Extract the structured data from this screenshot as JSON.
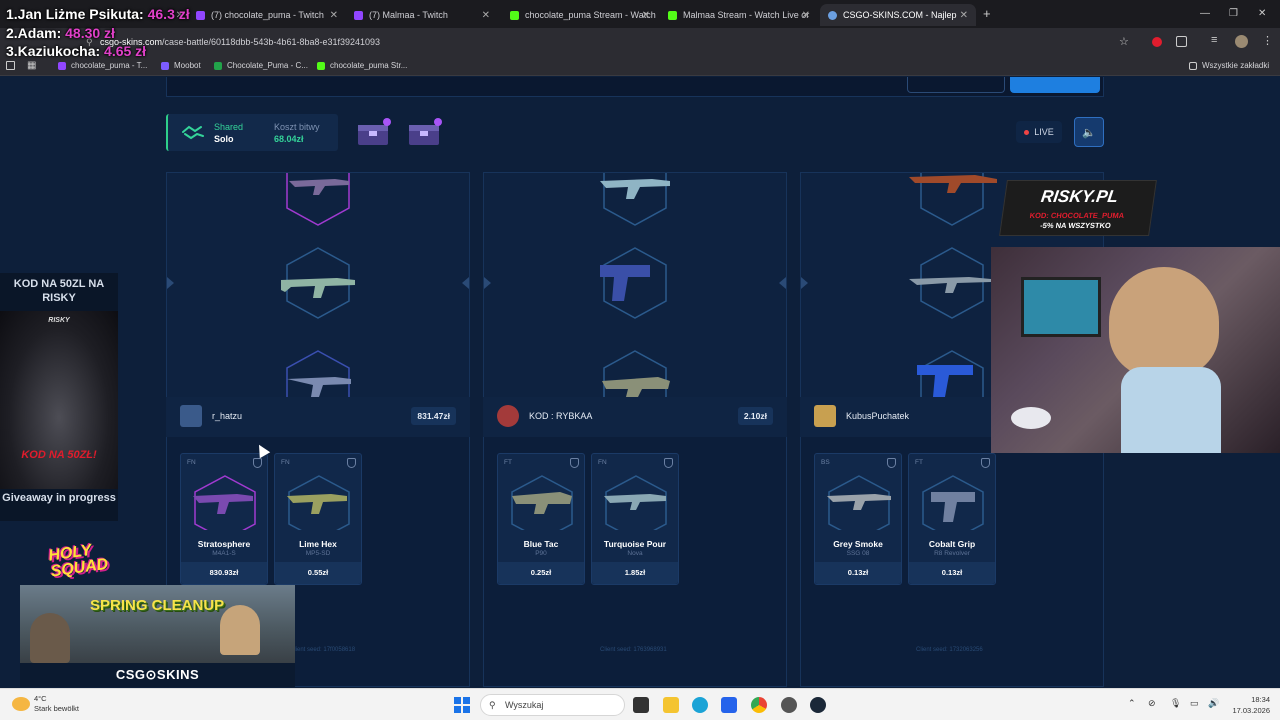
{
  "browser": {
    "tabs": [
      {
        "label": "",
        "color": "#9146ff"
      },
      {
        "label": "(7) chocolate_puma - Twitch",
        "color": "#9146ff"
      },
      {
        "label": "(7) Malmaa - Twitch",
        "color": "#9146ff"
      },
      {
        "label": "chocolate_puma Stream - Watch",
        "color": "#53fc18"
      },
      {
        "label": "Malmaa Stream - Watch Live or",
        "color": "#53fc18"
      },
      {
        "label": "CSGO-SKINS.COM - Najlep",
        "color": "#6b9fe0"
      }
    ],
    "url_domain": "csgo-skins.com",
    "url_path": "/case-battle/60118dbb-543b-4b61-8ba8-e31f39241093",
    "bookmarks": [
      {
        "label": "chocolate_puma - T...",
        "color": "#9146ff"
      },
      {
        "label": "Moobot",
        "color": "#7c5cff"
      },
      {
        "label": "Chocolate_Puma - C...",
        "color": "#22a34a"
      },
      {
        "label": "chocolate_puma Str...",
        "color": "#53fc18"
      }
    ],
    "bookmarks_right": "Wszystkie zakładki"
  },
  "leaderboard": [
    {
      "rank_name": "1.Jan Liżme Psikuta:",
      "amount": "46.3 zł"
    },
    {
      "rank_name": "2.Adam:",
      "amount": "48.30 zł"
    },
    {
      "rank_name": "3.Kaziukocha:",
      "amount": "4.65 zł"
    }
  ],
  "battle": {
    "mode_label": "Shared",
    "mode_value": "Solo",
    "cost_label": "Koszt bitwy",
    "cost_value": "68.04zł",
    "live_label": "LIVE",
    "players": [
      {
        "name": "r_hatzu",
        "total": "831.47zł",
        "avatar_color": "#3a5a8a",
        "items": [
          {
            "cond": "FN",
            "name": "Stratosphere",
            "weapon": "M4A1-S",
            "price": "830.93zł"
          },
          {
            "cond": "FN",
            "name": "Lime Hex",
            "weapon": "MP5-SD",
            "price": "0.55zł"
          }
        ],
        "seed": "Client seed: 17f0058618"
      },
      {
        "name": "KOD : RYBKAA",
        "total": "2.10zł",
        "avatar_color": "#a33a3a",
        "items": [
          {
            "cond": "FT",
            "name": "Blue Tac",
            "weapon": "P90",
            "price": "0.25zł"
          },
          {
            "cond": "FN",
            "name": "Turquoise Pour",
            "weapon": "Nova",
            "price": "1.85zł"
          }
        ],
        "seed": "Client seed: 1763968931"
      },
      {
        "name": "KubusPuchatek",
        "total": "",
        "avatar_color": "#c8a050",
        "items": [
          {
            "cond": "BS",
            "name": "Grey Smoke",
            "weapon": "SSG 08",
            "price": "0.13zł"
          },
          {
            "cond": "FT",
            "name": "Cobalt Grip",
            "weapon": "R8 Revolver",
            "price": "0.13zł"
          }
        ],
        "seed": "Client seed: 1732063256"
      }
    ]
  },
  "overlays": {
    "kod_title": "KOD NA 50ZL NA RISKY",
    "kod_image_brand": "RISKY",
    "kod_image_text": "KOD NA 50ZŁ!",
    "giveaway": "Giveaway in progress",
    "risky_brand": "RISKY.PL",
    "risky_code": "KOD: CHOCOLATE_PUMA",
    "risky_discount": "-5% NA WSZYSTKO",
    "holy_squad": "HOLY SQUAD",
    "spring_cleanup": "SPRING CLEANUP",
    "csgo_skins_logo": "CSG⊙SKINS"
  },
  "taskbar": {
    "weather_temp": "4°C",
    "weather_desc": "Stark bewölkt",
    "search_placeholder": "Wyszukaj",
    "time": "18:34",
    "date": "17.03.2026"
  }
}
